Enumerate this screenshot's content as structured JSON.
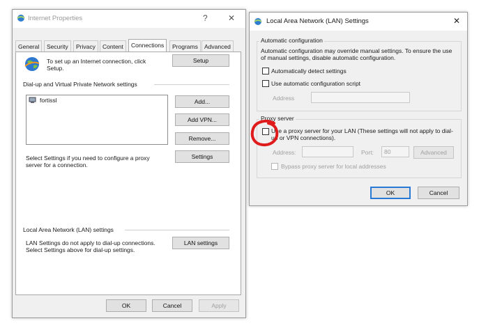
{
  "ie": {
    "title": "Internet Properties",
    "help_glyph": "?",
    "close_glyph": "✕",
    "tabs": [
      {
        "label": "General"
      },
      {
        "label": "Security"
      },
      {
        "label": "Privacy"
      },
      {
        "label": "Content"
      },
      {
        "label": "Connections"
      },
      {
        "label": "Programs"
      },
      {
        "label": "Advanced"
      }
    ],
    "active_tab": "Connections",
    "setup_text": "To set up an Internet connection, click Setup.",
    "setup_button": "Setup",
    "dialup_header": "Dial-up and Virtual Private Network settings",
    "vpn_items": [
      {
        "name": "fortissl"
      }
    ],
    "add_button": "Add...",
    "add_vpn_button": "Add VPN...",
    "remove_button": "Remove...",
    "settings_text": "Select Settings if you need to configure a proxy server for a connection.",
    "settings_button": "Settings",
    "lan_header": "Local Area Network (LAN) settings",
    "lan_text": "LAN Settings do not apply to dial-up connections. Select Settings above for dial-up settings.",
    "lan_button": "LAN settings",
    "ok": "OK",
    "cancel": "Cancel",
    "apply": "Apply"
  },
  "lan": {
    "title": "Local Area Network (LAN) Settings",
    "close_glyph": "✕",
    "auto_header": "Automatic configuration",
    "auto_text": "Automatic configuration may override manual settings.  To ensure the use of manual settings, disable automatic configuration.",
    "auto_detect": "Automatically detect settings",
    "auto_script": "Use automatic configuration script",
    "address_label": "Address",
    "proxy_header": "Proxy server",
    "use_proxy": "Use a proxy server for your LAN (These settings will not apply to dial-up or VPN connections).",
    "proxy_address_label": "Address:",
    "port_label": "Port:",
    "port_value": "80",
    "advanced_button": "Advanced",
    "bypass": "Bypass proxy server for local addresses",
    "ok": "OK",
    "cancel": "Cancel"
  },
  "colors": {
    "annotation": "#e01b1b",
    "focus": "#2a78d6"
  }
}
